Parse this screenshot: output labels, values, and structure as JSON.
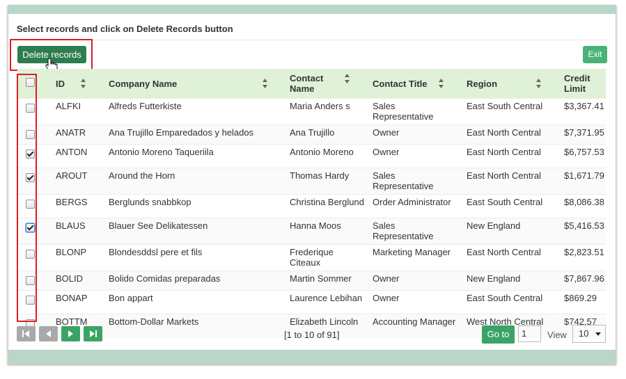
{
  "instruction": "Select records and click on Delete Records button",
  "toolbar": {
    "delete_label": "Delete records",
    "exit_label": "Exit"
  },
  "columns": {
    "id": "ID",
    "company": "Company Name",
    "contact_name": "Contact Name",
    "contact_title": "Contact Title",
    "region": "Region",
    "credit_limit": "Credit Limit"
  },
  "rows": [
    {
      "checked": false,
      "id": "ALFKI",
      "company": "Alfreds Futterkiste",
      "contact_name": "Maria Anders s",
      "contact_title": "Sales Representative",
      "region": "East South Central",
      "credit_limit": "$3,367.41"
    },
    {
      "checked": false,
      "id": "ANATR",
      "company": "Ana Trujillo Emparedados y helados",
      "contact_name": "Ana Trujillo",
      "contact_title": "Owner",
      "region": "East North Central",
      "credit_limit": "$7,371.95"
    },
    {
      "checked": true,
      "id": "ANTON",
      "company": "Antonio Moreno Taqueriila",
      "contact_name": "Antonio Moreno",
      "contact_title": "Owner",
      "region": "East North Central",
      "credit_limit": "$6,757.53"
    },
    {
      "checked": true,
      "id": "AROUT",
      "company": "Around the Horn",
      "contact_name": "Thomas Hardy",
      "contact_title": "Sales Representative",
      "region": "East North Central",
      "credit_limit": "$1,671.79"
    },
    {
      "checked": false,
      "id": "BERGS",
      "company": "Berglunds snabbkop",
      "contact_name": "Christina Berglund",
      "contact_title": "Order Administrator",
      "region": "East South Central",
      "credit_limit": "$8,086.38"
    },
    {
      "checked": true,
      "id": "BLAUS",
      "company": "Blauer See Delikatessen",
      "contact_name": "Hanna Moos",
      "contact_title": "Sales Representative",
      "region": "New England",
      "credit_limit": "$5,416.53"
    },
    {
      "checked": false,
      "id": "BLONP",
      "company": "Blondesddsl pere et fils",
      "contact_name": "Frederique Citeaux",
      "contact_title": "Marketing Manager",
      "region": "East North Central",
      "credit_limit": "$2,823.51"
    },
    {
      "checked": false,
      "id": "BOLID",
      "company": "Bolido Comidas preparadas",
      "contact_name": "Martin Sommer",
      "contact_title": "Owner",
      "region": "New England",
      "credit_limit": "$7,867.96"
    },
    {
      "checked": false,
      "id": "BONAP",
      "company": "Bon appart",
      "contact_name": "Laurence Lebihan",
      "contact_title": "Owner",
      "region": "East South Central",
      "credit_limit": "$869.29"
    },
    {
      "checked": false,
      "id": "BOTTM",
      "company": "Bottom-Dollar Markets",
      "contact_name": "Elizabeth Lincoln",
      "contact_title": "Accounting Manager",
      "region": "West North Central",
      "credit_limit": "$742.57"
    }
  ],
  "pager": {
    "info": "[1 to 10 of 91]",
    "go_label": "Go to",
    "page_value": "1",
    "view_label": "View",
    "page_size": "10"
  },
  "icons": {
    "first": "first-page-icon",
    "prev": "prev-page-icon",
    "next": "next-page-icon",
    "last": "last-page-icon",
    "sort": "sort-icon",
    "cursor": "hand-cursor-icon"
  },
  "colors": {
    "header_bg": "#dff1d7",
    "delete_button": "#2e7d4f",
    "accent_green": "#3aa466",
    "highlight_red": "#d91f1f",
    "frame_bar": "#b9d7c6"
  }
}
